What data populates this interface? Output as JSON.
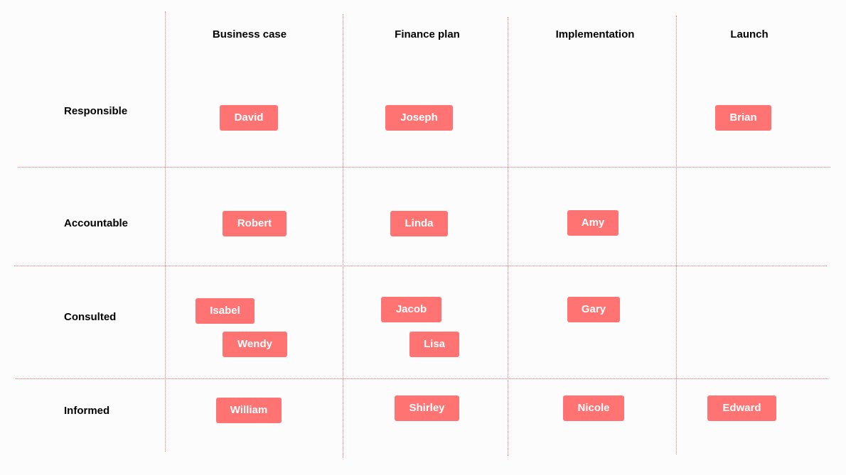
{
  "columns": [
    "Business case",
    "Finance plan",
    "Implementation",
    "Launch"
  ],
  "rows": [
    "Responsible",
    "Accountable",
    "Consulted",
    "Informed"
  ],
  "cards": [
    "David",
    "Joseph",
    "Brian",
    "Robert",
    "Linda",
    "Amy",
    "Isabel",
    "Wendy",
    "Jacob",
    "Lisa",
    "Gary",
    "William",
    "Shirley",
    "Nicole",
    "Edward"
  ],
  "colors": {
    "card": "#ff7373",
    "grid": "#ff7373",
    "background": "#fcfcfc"
  }
}
